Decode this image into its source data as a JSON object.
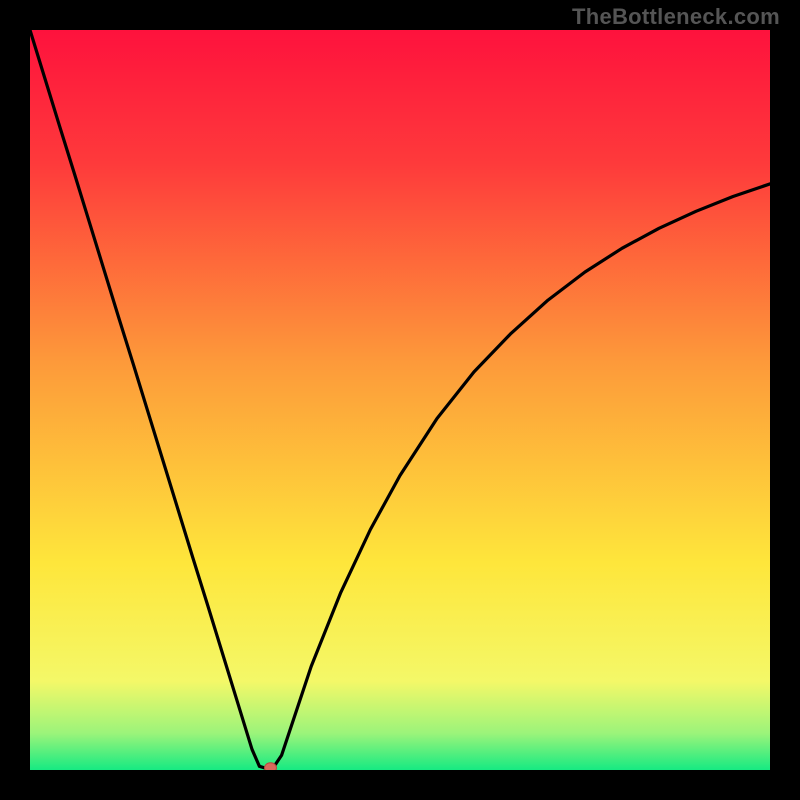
{
  "watermark": "TheBottleneck.com",
  "colors": {
    "frame": "#000000",
    "top": "#fe123d",
    "mid": "#fee63b",
    "bottom": "#16ea82",
    "curve": "#000000",
    "marker": "#d86a5c"
  },
  "chart_data": {
    "type": "line",
    "title": "",
    "xlabel": "",
    "ylabel": "",
    "xlim": [
      0,
      100
    ],
    "ylim": [
      0,
      100
    ],
    "grid": false,
    "legend": null,
    "annotations": [],
    "series": [
      {
        "name": "bottleneck-curve",
        "x": [
          0,
          2,
          4,
          6,
          8,
          10,
          12,
          14,
          16,
          18,
          20,
          22,
          24,
          26,
          28,
          30,
          31,
          32,
          33,
          34,
          35,
          38,
          42,
          46,
          50,
          55,
          60,
          65,
          70,
          75,
          80,
          85,
          90,
          95,
          100
        ],
        "y": [
          100,
          93.5,
          87,
          80.6,
          74.1,
          67.6,
          61.1,
          54.7,
          48.2,
          41.7,
          35.2,
          28.7,
          22.3,
          15.8,
          9.3,
          2.8,
          0.5,
          0.2,
          0.5,
          2.0,
          5.0,
          14.0,
          24.0,
          32.5,
          39.8,
          47.5,
          53.8,
          59.0,
          63.5,
          67.3,
          70.5,
          73.2,
          75.5,
          77.5,
          79.2
        ]
      }
    ],
    "marker": {
      "x": 32.5,
      "y": 0.3
    }
  }
}
